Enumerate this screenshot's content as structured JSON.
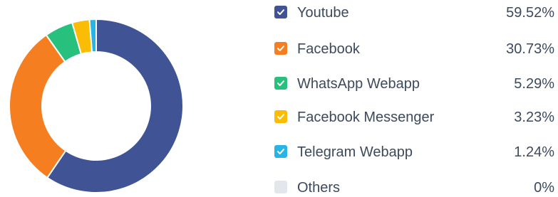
{
  "chart_data": {
    "type": "pie",
    "donut": true,
    "title": "",
    "legend_position": "right",
    "slices": [
      {
        "label": "Youtube",
        "value": 59.52,
        "display": "59.52%",
        "color": "#3f5395",
        "checked": true
      },
      {
        "label": "Facebook",
        "value": 30.73,
        "display": "30.73%",
        "color": "#f57f20",
        "checked": true
      },
      {
        "label": "WhatsApp Webapp",
        "value": 5.29,
        "display": "5.29%",
        "color": "#27c07d",
        "checked": true
      },
      {
        "label": "Facebook Messenger",
        "value": 3.23,
        "display": "3.23%",
        "color": "#fbbc05",
        "checked": true
      },
      {
        "label": "Telegram Webapp",
        "value": 1.24,
        "display": "1.24%",
        "color": "#26b5e6",
        "checked": true
      },
      {
        "label": "Others",
        "value": 0,
        "display": "0%",
        "color": "#e3e7ec",
        "checked": false
      }
    ]
  }
}
